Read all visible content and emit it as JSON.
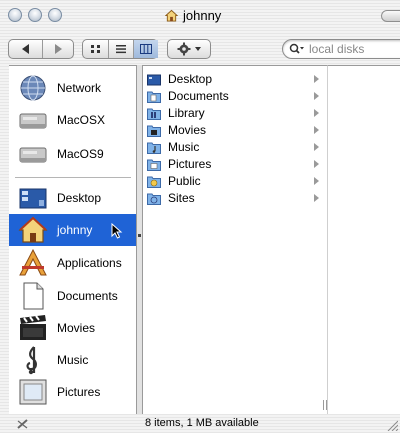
{
  "window": {
    "title": "johnny"
  },
  "toolbar": {
    "search_placeholder": "local disks"
  },
  "sidebar": {
    "devices": [
      {
        "label": "Network",
        "icon": "network-globe-icon"
      },
      {
        "label": "MacOSX",
        "icon": "hard-disk-icon"
      },
      {
        "label": "MacOS9",
        "icon": "hard-disk-icon"
      }
    ],
    "places": [
      {
        "label": "Desktop",
        "icon": "desktop-icon"
      },
      {
        "label": "johnny",
        "icon": "home-icon",
        "selected": true
      },
      {
        "label": "Applications",
        "icon": "applications-icon"
      },
      {
        "label": "Documents",
        "icon": "document-icon"
      },
      {
        "label": "Movies",
        "icon": "clapperboard-icon"
      },
      {
        "label": "Music",
        "icon": "music-clef-icon"
      },
      {
        "label": "Pictures",
        "icon": "picture-frame-icon"
      }
    ]
  },
  "column": {
    "items": [
      {
        "label": "Desktop",
        "icon": "desktop-folder-icon"
      },
      {
        "label": "Documents",
        "icon": "documents-folder-icon"
      },
      {
        "label": "Library",
        "icon": "library-folder-icon"
      },
      {
        "label": "Movies",
        "icon": "movies-folder-icon"
      },
      {
        "label": "Music",
        "icon": "music-folder-icon"
      },
      {
        "label": "Pictures",
        "icon": "pictures-folder-icon"
      },
      {
        "label": "Public",
        "icon": "public-folder-icon"
      },
      {
        "label": "Sites",
        "icon": "sites-folder-icon"
      }
    ]
  },
  "status": {
    "text": "8 items, 1 MB available"
  },
  "colors": {
    "selection": "#1f63d6",
    "folder": "#7fb2e8"
  }
}
